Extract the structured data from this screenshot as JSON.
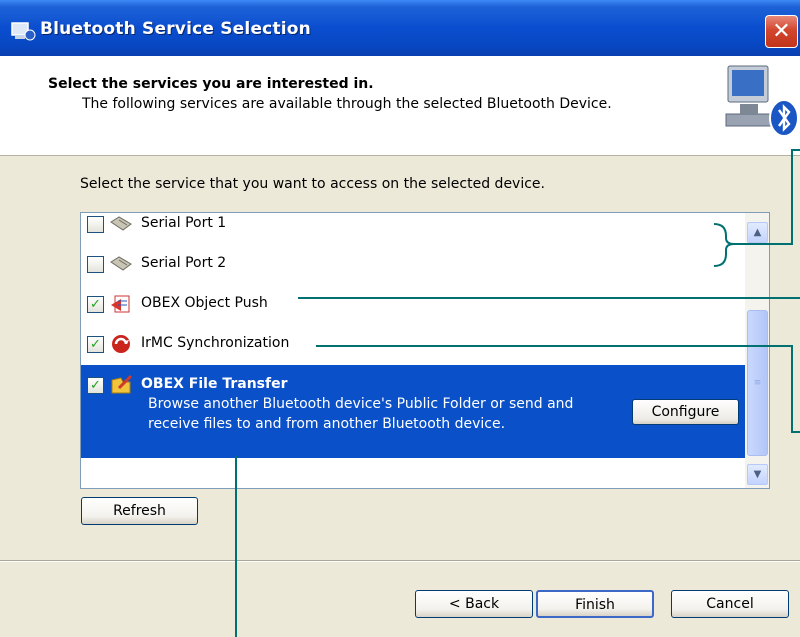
{
  "window": {
    "title": "Bluetooth Service Selection",
    "close_glyph": "✕"
  },
  "header": {
    "title": "Select the services you are interested in.",
    "subtitle": "The following services are available through the selected Bluetooth Device."
  },
  "instruction": "Select the service that you want to access on the selected device.",
  "services": [
    {
      "label": "Serial Port 1",
      "checked": false,
      "icon": "serial-port-icon"
    },
    {
      "label": "Serial Port 2",
      "checked": false,
      "icon": "serial-port-icon"
    },
    {
      "label": "OBEX Object Push",
      "checked": true,
      "icon": "object-push-icon"
    },
    {
      "label": "IrMC Synchronization",
      "checked": true,
      "icon": "sync-icon"
    },
    {
      "label": "OBEX File Transfer",
      "checked": true,
      "selected": true,
      "icon": "file-transfer-icon",
      "description_line1": "Browse another Bluetooth device's Public Folder or send and",
      "description_line2": "receive files to and from another Bluetooth device.",
      "configure_label": "Configure"
    }
  ],
  "buttons": {
    "refresh": "Refresh",
    "back": "Back",
    "finish": "Finish",
    "cancel": "Cancel",
    "back_prefix": "< "
  },
  "colors": {
    "titlebar": "#0a4ecf",
    "selection": "#0a50c8",
    "callout_line": "#007070"
  }
}
